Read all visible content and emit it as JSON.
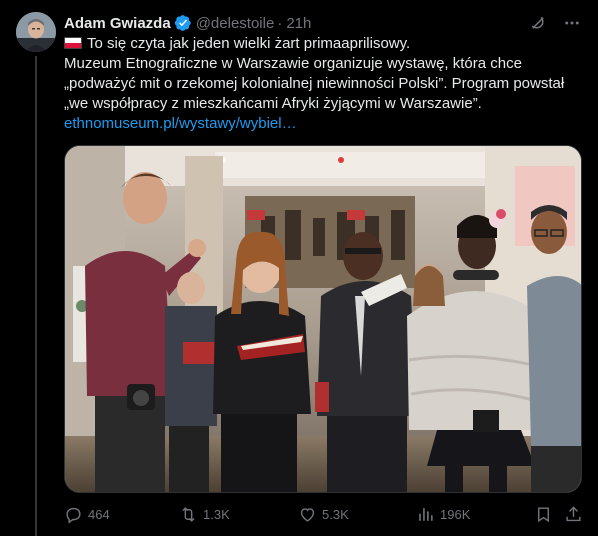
{
  "author": {
    "display_name": "Adam Gwiazda",
    "handle": "@delestoile",
    "separator": "·",
    "time": "21h",
    "verified_color": "#1d9bf0"
  },
  "header_icons": {
    "grok": "grok-icon",
    "more": "more-dots-icon"
  },
  "tweet": {
    "flag": "poland-flag",
    "line1": "To się czyta jak jeden wielki żart primaaprilisowy.",
    "line2": "Muzeum Etnograficzne w Warszawie organizuje wystawę, która chce „podważyć mit o rzekomej kolonialnej niewinności Polski”. Program powstał „we współpracy z mieszkańcami Afryki żyjącymi w Warszawie”.",
    "link": "ethnomuseum.pl/wystawy/wybiel…",
    "link_color": "#1d9bf0"
  },
  "media": {
    "description_icon": "photo"
  },
  "actions": {
    "replies": "464",
    "retweets": "1.3K",
    "likes": "5.3K",
    "views": "196K"
  },
  "colors": {
    "background": "#000000",
    "text": "#e7e9ea",
    "muted": "#71767b",
    "accent": "#1d9bf0"
  }
}
